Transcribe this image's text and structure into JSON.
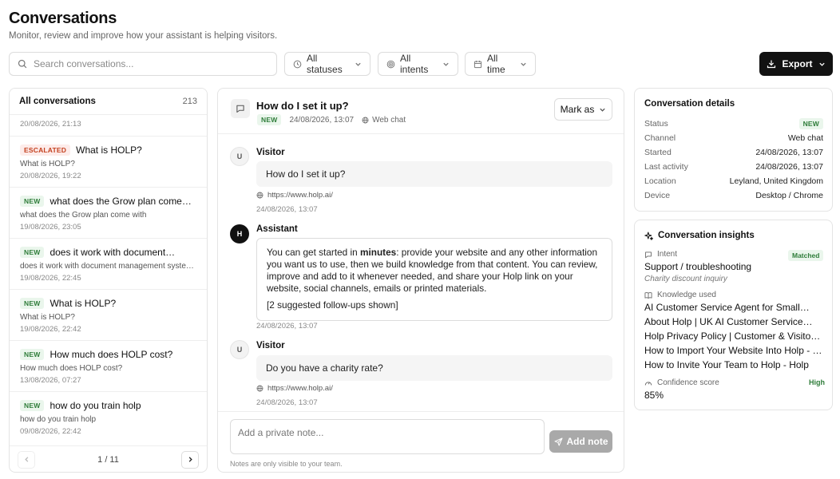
{
  "header": {
    "title": "Conversations",
    "subtitle": "Monitor, review and improve how your assistant is helping visitors."
  },
  "toolbar": {
    "search_placeholder": "Search conversations...",
    "filter_status": "All statuses",
    "filter_intent": "All intents",
    "filter_time": "All time",
    "export_label": "Export"
  },
  "list": {
    "title": "All conversations",
    "count": "213",
    "partial_date": "20/08/2026, 21:13",
    "items": [
      {
        "badge": "ESCALATED",
        "badge_type": "escalated",
        "title": "What is HOLP?",
        "preview": "What is HOLP?",
        "date": "20/08/2026, 19:22"
      },
      {
        "badge": "NEW",
        "badge_type": "new",
        "title": "what does the Grow plan come with",
        "preview": "what does the Grow plan come with",
        "date": "19/08/2026, 23:05"
      },
      {
        "badge": "NEW",
        "badge_type": "new",
        "title": "does it work with document…",
        "preview": "does it work with document management systems?",
        "date": "19/08/2026, 22:45"
      },
      {
        "badge": "NEW",
        "badge_type": "new",
        "title": "What is HOLP?",
        "preview": "What is HOLP?",
        "date": "19/08/2026, 22:42"
      },
      {
        "badge": "NEW",
        "badge_type": "new",
        "title": "How much does HOLP cost?",
        "preview": "How much does HOLP cost?",
        "date": "13/08/2026, 07:27"
      },
      {
        "badge": "NEW",
        "badge_type": "new",
        "title": "how do you train holp",
        "preview": "how do you train holp",
        "date": "09/08/2026, 22:42"
      }
    ],
    "pagination": "1 / 11"
  },
  "chat": {
    "title": "How do I set it up?",
    "status_badge": "NEW",
    "date": "24/08/2026, 13:07",
    "channel": "Web chat",
    "mark_as_label": "Mark as",
    "messages": [
      {
        "avatar": "U",
        "sender": "Visitor",
        "text": "How do I set it up?",
        "url": "https://www.holp.ai/",
        "time": "24/08/2026, 13:07"
      },
      {
        "avatar": "H",
        "sender": "Assistant",
        "text_before": "You can get started in ",
        "text_bold": "minutes",
        "text_after": ": provide your website and any other information you want us to use, then we build knowledge from that content. You can review, improve and add to it whenever needed, and share your Holp link on your website, social channels, emails or printed materials.",
        "note": "[2 suggested follow-ups shown]",
        "time": "24/08/2026, 13:07"
      },
      {
        "avatar": "U",
        "sender": "Visitor",
        "text": "Do you have a charity rate?",
        "url": "https://www.holp.ai/",
        "time": "24/08/2026, 13:07"
      }
    ],
    "note_placeholder": "Add a private note...",
    "add_note_label": "Add note",
    "note_hint": "Notes are only visible to your team."
  },
  "details": {
    "title": "Conversation details",
    "rows": [
      {
        "label": "Status",
        "value": "NEW"
      },
      {
        "label": "Channel",
        "value": "Web chat"
      },
      {
        "label": "Started",
        "value": "24/08/2026, 13:07"
      },
      {
        "label": "Last activity",
        "value": "24/08/2026, 13:07"
      },
      {
        "label": "Location",
        "value": "Leyland, United Kingdom"
      },
      {
        "label": "Device",
        "value": "Desktop / Chrome"
      }
    ]
  },
  "insights": {
    "title": "Conversation insights",
    "intent_label": "Intent",
    "intent_badge": "Matched",
    "intent_value": "Support / troubleshooting",
    "intent_sub": "Charity discount inquiry",
    "knowledge_label": "Knowledge used",
    "knowledge": [
      "AI Customer Service Agent for Small…",
      "About Holp | UK AI Customer Service…",
      "Holp Privacy Policy | Customer & Visitor Data",
      "How to Import Your Website Into Holp - Holp",
      "How to Invite Your Team to Holp - Holp"
    ],
    "confidence_label": "Confidence score",
    "confidence_badge": "High",
    "confidence_value": "85%"
  },
  "colors": {
    "primary": "#121212",
    "new_badge_bg": "#eaf6ec",
    "new_badge_fg": "#2f7d3a",
    "escalated_bg": "#fdecea",
    "escalated_fg": "#c4411f",
    "disabled_button": "#a9a9a9"
  }
}
